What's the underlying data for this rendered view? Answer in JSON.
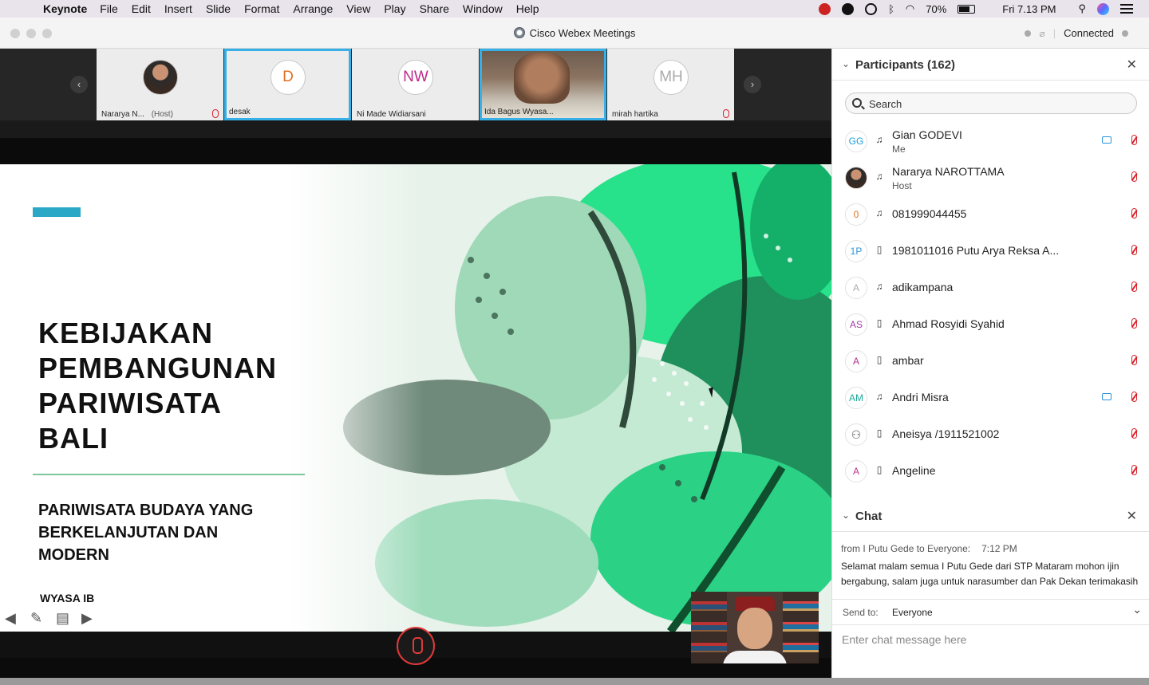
{
  "menubar": {
    "app": "Keynote",
    "menus": [
      "File",
      "Edit",
      "Insert",
      "Slide",
      "Format",
      "Arrange",
      "View",
      "Play",
      "Share",
      "Window",
      "Help"
    ],
    "battery": "70%",
    "clock": "Fri 7.13 PM"
  },
  "window": {
    "title": "Cisco Webex Meetings",
    "status": "Connected"
  },
  "filmstrip": [
    {
      "name": "Nararya N...",
      "role": "(Host)",
      "initials": "",
      "active": false
    },
    {
      "name": "desak",
      "role": "",
      "initials": "D",
      "active": true
    },
    {
      "name": "Ni Made Widiarsani",
      "role": "",
      "initials": "NW",
      "active": false
    },
    {
      "name": "Ida Bagus Wyasa...",
      "role": "",
      "initials": "",
      "active": true
    },
    {
      "name": "mirah hartika",
      "role": "",
      "initials": "MH",
      "active": false
    }
  ],
  "slide": {
    "title_lines": [
      "KEBIJAKAN",
      "PEMBANGUNAN",
      "PARIWISATA",
      "BALI"
    ],
    "subtitle_lines": [
      "PARIWISATA BUDAYA YANG",
      "BERKELANJUTAN DAN",
      "MODERN"
    ],
    "author": "WYASA IB",
    "accent_color": "#2aa8c6"
  },
  "participants": {
    "header": "Participants (162)",
    "search_placeholder": "Search",
    "items": [
      {
        "initials": "GG",
        "color": "#1a9fd6",
        "name": "Gian GODEVI",
        "sub": "Me",
        "device": "headset",
        "video": true
      },
      {
        "initials": "",
        "color": "#555555",
        "name": "Nararya NAROTTAMA",
        "sub": "Host",
        "device": "headset",
        "video": false
      },
      {
        "initials": "0",
        "color": "#e07020",
        "name": "081999044455",
        "sub": "",
        "device": "headset",
        "video": false
      },
      {
        "initials": "1P",
        "color": "#2a94d8",
        "name": "1981011016 Putu Arya Reksa A...",
        "sub": "",
        "device": "phone",
        "video": false
      },
      {
        "initials": "A",
        "color": "#aaaaaa",
        "name": "adikampana",
        "sub": "",
        "device": "headset",
        "video": false
      },
      {
        "initials": "AS",
        "color": "#a03aa8",
        "name": "Ahmad Rosyidi Syahid",
        "sub": "",
        "device": "phone",
        "video": false
      },
      {
        "initials": "A",
        "color": "#b0308a",
        "name": "ambar",
        "sub": "",
        "device": "phone",
        "video": false
      },
      {
        "initials": "AM",
        "color": "#1aa89a",
        "name": "Andri Misra",
        "sub": "",
        "device": "headset",
        "video": true
      },
      {
        "initials": "",
        "color": "#555555",
        "name": "Aneisya /1911521002",
        "sub": "",
        "device": "phone",
        "video": false
      },
      {
        "initials": "A",
        "color": "#c0308a",
        "name": "Angeline",
        "sub": "",
        "device": "phone",
        "video": false
      }
    ]
  },
  "chat": {
    "header": "Chat",
    "from": "from I Putu Gede to Everyone:",
    "time": "7:12  PM",
    "message": "Selamat malam  semua I Putu Gede dari STP Mataram mohon ijin bergabung, salam juga untuk narasumber dan Pak Dekan terimakasih",
    "send_to_label": "Send to:",
    "send_to_value": "Everyone",
    "input_placeholder": "Enter chat message here"
  }
}
